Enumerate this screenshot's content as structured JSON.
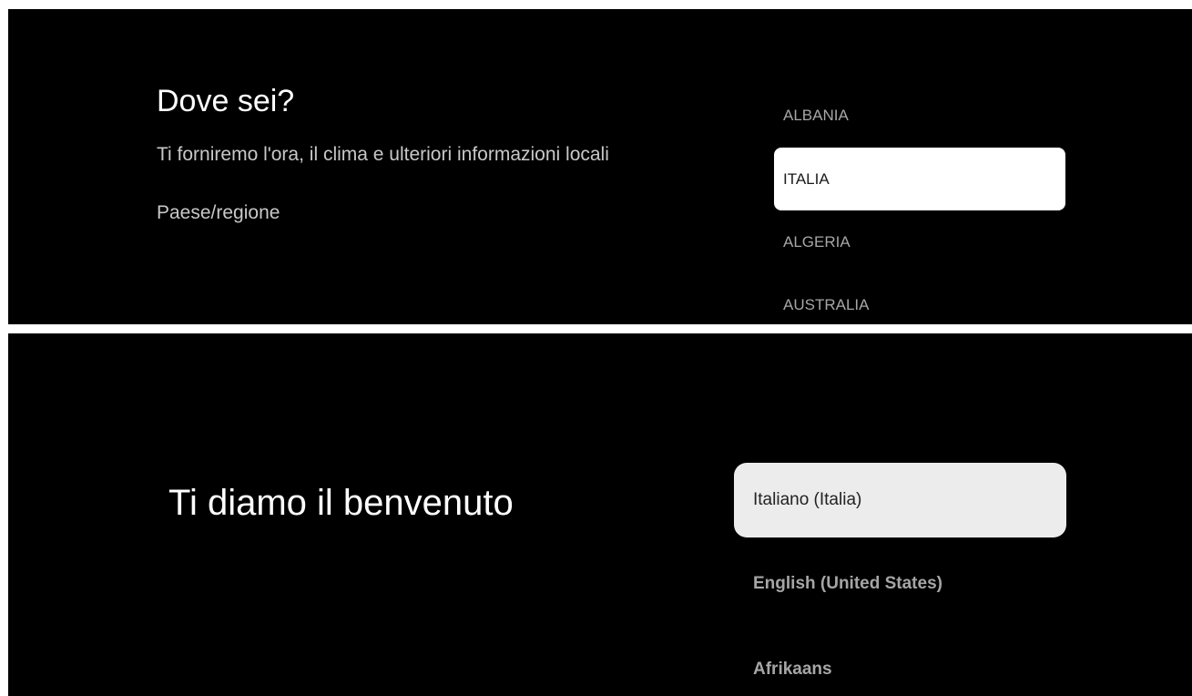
{
  "region_screen": {
    "title": "Dove sei?",
    "subtitle": "Ti forniremo l'ora, il clima e ulteriori informazioni locali",
    "field_label": "Paese/regione",
    "countries": [
      {
        "label": "ALBANIA",
        "selected": false
      },
      {
        "label": "ITALIA",
        "selected": true
      },
      {
        "label": "ALGERIA",
        "selected": false
      },
      {
        "label": "AUSTRALIA",
        "selected": false
      }
    ]
  },
  "welcome_screen": {
    "title": "Ti diamo il benvenuto",
    "languages": [
      {
        "label": "Italiano (Italia)",
        "selected": true
      },
      {
        "label": "English (United States)",
        "selected": false
      },
      {
        "label": "Afrikaans",
        "selected": false
      }
    ]
  },
  "colors": {
    "background": "#000000",
    "selected_item_bg": "#ffffff",
    "selected_language_bg": "#ececec",
    "muted_text": "#a6a6a6"
  }
}
